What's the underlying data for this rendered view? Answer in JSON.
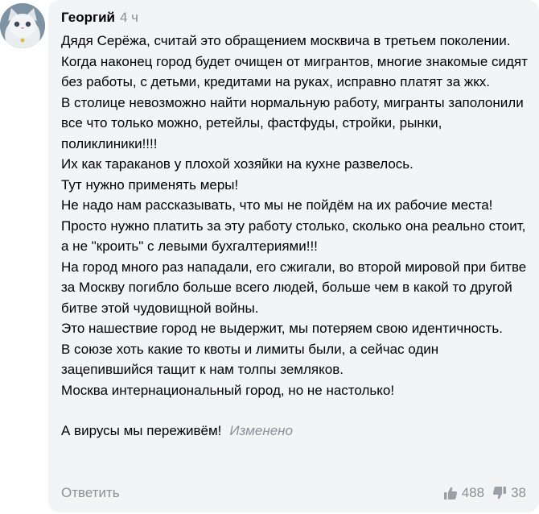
{
  "comment": {
    "author": "Георгий",
    "time": "4 ч",
    "paragraphs": [
      "Дядя Серёжа, считай это обращением москвича в третьем поколении.",
      "Когда наконец город будет очищен от мигрантов, многие знакомые сидят без работы, с детьми, кредитами на руках, исправно платят за жкх.",
      "В столице невозможно найти нормальную работу, мигранты заполонили все что только можно, ретейлы, фастфуды, стройки, рынки, поликлиники!!!!",
      "Их как тараканов у плохой хозяйки на кухне развелось.",
      "Тут нужно применять меры!",
      "Не надо нам рассказывать, что мы не пойдём на их рабочие места!",
      "Просто нужно платить за эту работу столько, сколько она реально стоит, а не \"кроить\" с левыми бухгалтериями!!!",
      "На город много раз нападали, его сжигали, во второй мировой при битве за Москву погибло больше всего людей, больше чем в какой то другой битве этой чудовищной войны.",
      "Это нашествие город не выдержит, мы потеряем свою идентичность.",
      "В союзе хоть какие то квоты и лимиты были, а сейчас один зацепившийся тащит к нам толпы земляков.",
      "Москва интернациональный город, но не настолько!"
    ],
    "last_line": "А вирусы мы переживём!",
    "edited_label": "Изменено",
    "reply_label": "Ответить",
    "likes": "488",
    "dislikes": "38",
    "icons": {
      "avatar": "cat-avatar",
      "like": "thumbs-up-icon",
      "dislike": "thumbs-down-icon"
    },
    "colors": {
      "bubble": "#f3f4f6",
      "muted": "#8b8f96"
    }
  }
}
